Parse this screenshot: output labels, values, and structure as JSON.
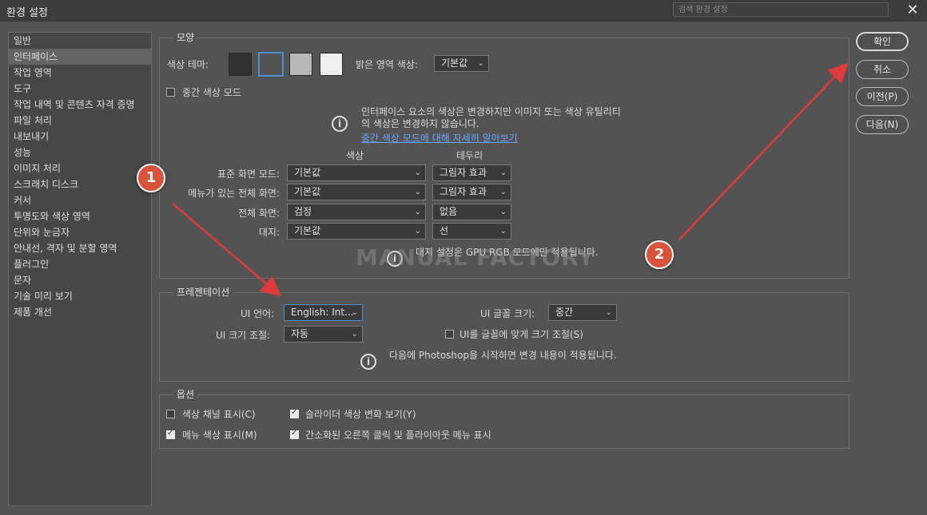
{
  "window": {
    "title": "환경 설정",
    "search_placeholder": "검색 환경 설정"
  },
  "sidebar": {
    "items": [
      {
        "label": "일반"
      },
      {
        "label": "인터페이스"
      },
      {
        "label": "작업 영역"
      },
      {
        "label": "도구"
      },
      {
        "label": "작업 내역 및 콘텐츠 자격 증명"
      },
      {
        "label": "파일 처리"
      },
      {
        "label": "내보내기"
      },
      {
        "label": "성능"
      },
      {
        "label": "이미지 처리"
      },
      {
        "label": "스크래치 디스크"
      },
      {
        "label": "커서"
      },
      {
        "label": "투명도와 색상 영역"
      },
      {
        "label": "단위와 눈금자"
      },
      {
        "label": "안내선, 격자 및 분할 영역"
      },
      {
        "label": "플러그인"
      },
      {
        "label": "문자"
      },
      {
        "label": "기술 미리 보기"
      },
      {
        "label": "제품 개선"
      }
    ],
    "active_index": 1
  },
  "appearance": {
    "legend": "모양",
    "color_theme_label": "색상 테마:",
    "themes": [
      {
        "name": "darkest",
        "color": "#323232",
        "selected": false
      },
      {
        "name": "dark",
        "color": "#535353",
        "selected": true
      },
      {
        "name": "light",
        "color": "#b8b8b8",
        "selected": false
      },
      {
        "name": "lightest",
        "color": "#f0f0f0",
        "selected": false
      }
    ],
    "highlight_label": "밝은 영역 색상:",
    "highlight_value": "기본값",
    "mid_gray_label": "중간 색상 모드",
    "info_line1": "인터페이스 요소의 색상은 변경하지만 이미지 또는 색상 유틸리티",
    "info_line2": "의 색상은 변경하지 않습니다.",
    "info_link": "중간 색상 모드에 대해 자세히 알아보기",
    "col_color": "색상",
    "col_border": "테두리",
    "rows": [
      {
        "label": "표준 화면 모드:",
        "color": "기본값",
        "border": "그림자 효과"
      },
      {
        "label": "메뉴가 있는 전체 화면:",
        "color": "기본값",
        "border": "그림자 효과"
      },
      {
        "label": "전체 화면:",
        "color": "검정",
        "border": "없음"
      },
      {
        "label": "대지:",
        "color": "기본값",
        "border": "선"
      }
    ],
    "artboard_note": "대지 설정은 GPU RGB 모드에만 적용됩니다."
  },
  "presentation": {
    "legend": "프레젠테이션",
    "ui_language_label": "UI 언어:",
    "ui_language_value": "English: Int...",
    "ui_font_size_label": "UI 글꼴 크기:",
    "ui_font_size_value": "중간",
    "ui_scaling_label": "UI 크기 조절:",
    "ui_scaling_value": "자동",
    "scale_to_font_label": "UI를 글꼴에 맞게 크기 조절(S)",
    "restart_note": "다음에 Photoshop을 시작하면 변경 내용이 적용됩니다."
  },
  "options": {
    "legend": "옵션",
    "channels_in_color": {
      "label": "색상 채널 표시(C)",
      "checked": false
    },
    "dynamic_sliders": {
      "label": "슬라이더 색상 변화 보기(Y)",
      "checked": true
    },
    "menu_colors": {
      "label": "메뉴 색상 표시(M)",
      "checked": true
    },
    "condensed_menus": {
      "label": "간소화된 오른쪽 클릭 및 플라이아웃 메뉴 표시",
      "checked": true
    }
  },
  "buttons": {
    "ok": "확인",
    "cancel": "취소",
    "prev": "이전(P)",
    "next": "다음(N)"
  },
  "watermark": "MANUAL FACTORY",
  "annotations": [
    {
      "number": "1"
    },
    {
      "number": "2"
    }
  ],
  "colors": {
    "background": "#535353",
    "accent_red": "#e03a3a",
    "link": "#6aa6ff",
    "badge": "#d9533a"
  }
}
